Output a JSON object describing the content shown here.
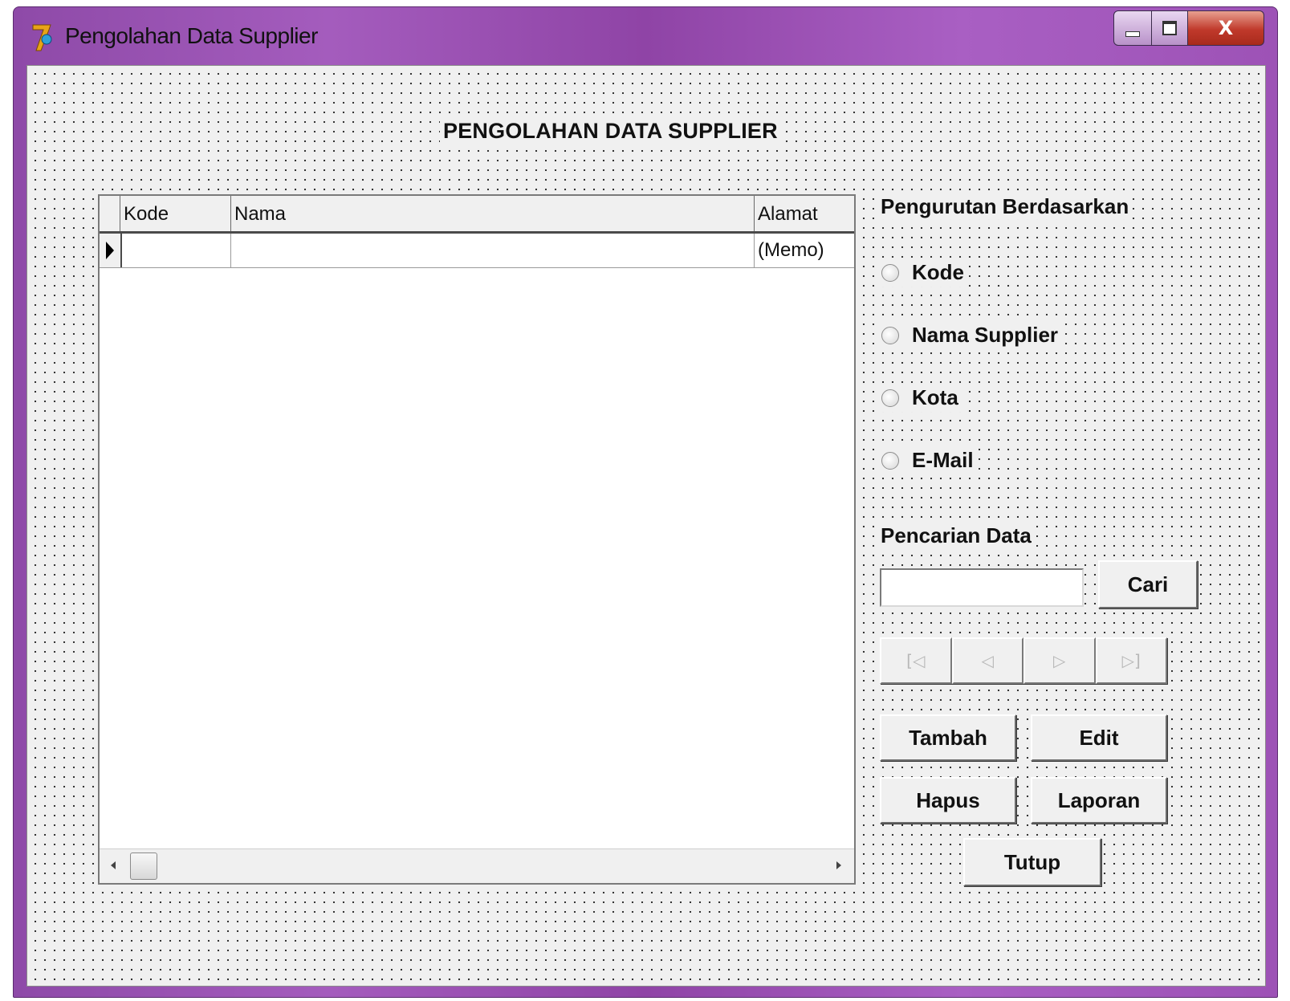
{
  "window": {
    "title": "Pengolahan Data Supplier",
    "controls": {
      "minimize": "minimize-icon",
      "maximize": "maximize-icon",
      "close": "X"
    }
  },
  "form": {
    "heading": "PENGOLAHAN DATA SUPPLIER"
  },
  "grid": {
    "columns": [
      "Kode",
      "Nama",
      "Alamat"
    ],
    "rows": [
      {
        "kode": "",
        "nama": "",
        "alamat": "(Memo)"
      }
    ]
  },
  "sort": {
    "label": "Pengurutan Berdasarkan",
    "options": [
      "Kode",
      "Nama Supplier",
      "Kota",
      "E-Mail"
    ],
    "selected": null
  },
  "search": {
    "label": "Pencarian Data",
    "value": "",
    "button": "Cari"
  },
  "navigator": {
    "icons": [
      "first-record-icon",
      "prior-record-icon",
      "next-record-icon",
      "last-record-icon"
    ],
    "glyphs": [
      "[◁",
      "◁",
      "▷",
      "▷]"
    ]
  },
  "actions": {
    "tambah": "Tambah",
    "edit": "Edit",
    "hapus": "Hapus",
    "laporan": "Laporan",
    "tutup": "Tutup"
  },
  "colors": {
    "titlebar": "#9d52b6",
    "form_background": "#f0f0f0",
    "close_button": "#c0392b"
  }
}
